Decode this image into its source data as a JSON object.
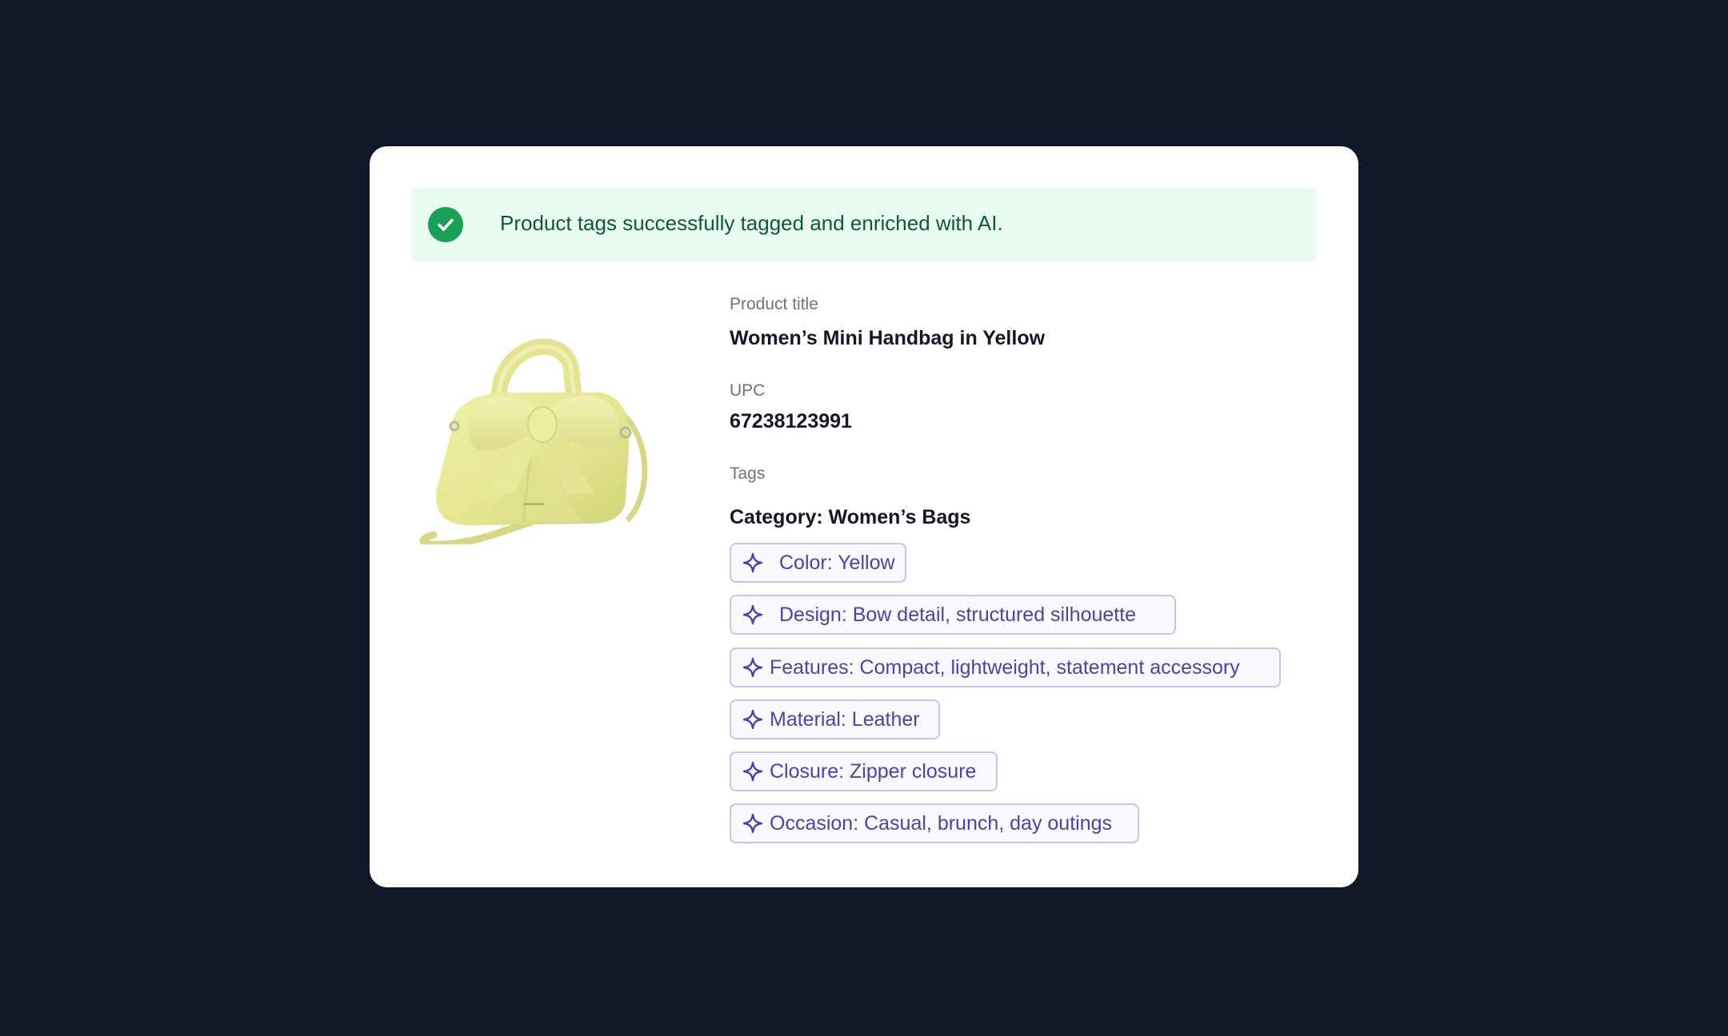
{
  "banner": {
    "message": "Product tags successfully tagged and enriched with AI.",
    "status_color": "#17a058",
    "icon": "check-circle-icon"
  },
  "product": {
    "title_label": "Product title",
    "title": "Women’s Mini Handbag in Yellow",
    "upc_label": "UPC",
    "upc": "67238123991",
    "tags_label": "Tags",
    "category": "Category: Women’s Bags",
    "image_alt": "yellow mini handbag with bow",
    "tag_icon": "sparkle-icon",
    "tags": [
      "Color: Yellow",
      "Design: Bow detail, structured silhouette",
      "Features: Compact, lightweight, statement accessory",
      "Material: Leather",
      "Closure: Zipper closure",
      "Occasion: Casual, brunch, day outings"
    ]
  },
  "colors": {
    "background": "#111827",
    "card": "#ffffff",
    "banner_bg": "#e9fbf0",
    "tag_text": "#4d3fb4",
    "tag_border": "#c8c3f4"
  }
}
